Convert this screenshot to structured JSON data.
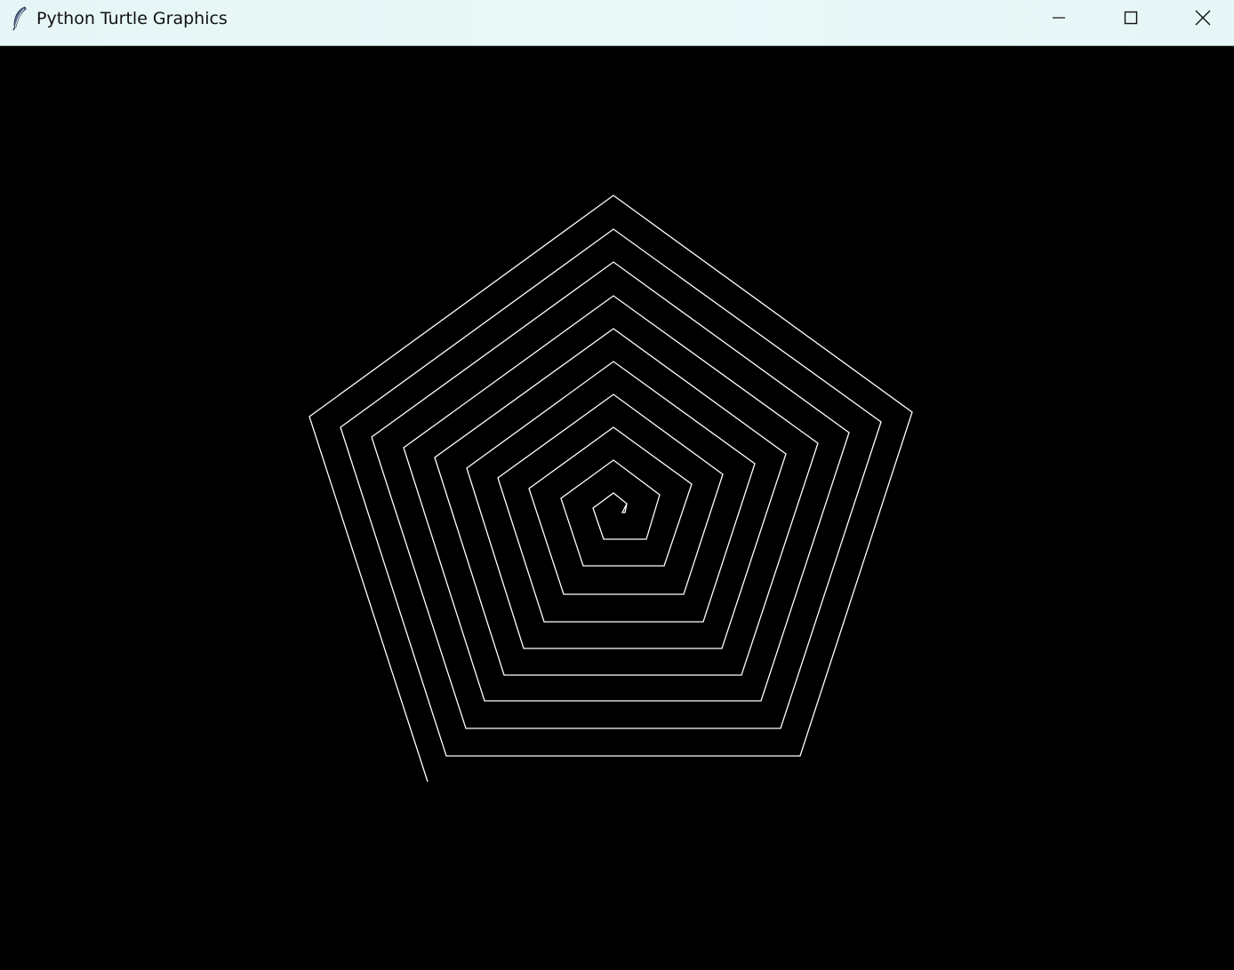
{
  "window": {
    "title": "Python Turtle Graphics",
    "icon": "feather-icon"
  },
  "controls": {
    "minimize_icon": "minimize-icon",
    "maximize_icon": "maximize-icon",
    "close_icon": "close-icon"
  },
  "canvas": {
    "background_color": "#000000",
    "pen_color": "#ffffff",
    "drawing": "pentagon-spiral",
    "sides": 5
  }
}
